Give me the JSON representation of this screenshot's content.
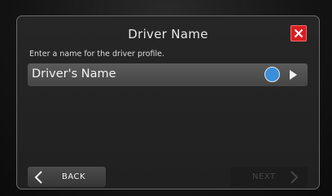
{
  "dialog": {
    "title": "Driver Name",
    "instruction": "Enter a name for the driver profile.",
    "name_field_label": "Driver's Name",
    "name_radio_selected": true
  },
  "footer": {
    "back_label": "BACK",
    "next_label": "NEXT",
    "next_enabled": false
  },
  "icons": {
    "close": "close-icon",
    "back": "chevron-left-icon",
    "next": "chevron-right-icon",
    "row_arrow": "play-arrow-icon"
  },
  "colors": {
    "close_bg": "#d81e22",
    "radio": "#3b8fd9"
  }
}
